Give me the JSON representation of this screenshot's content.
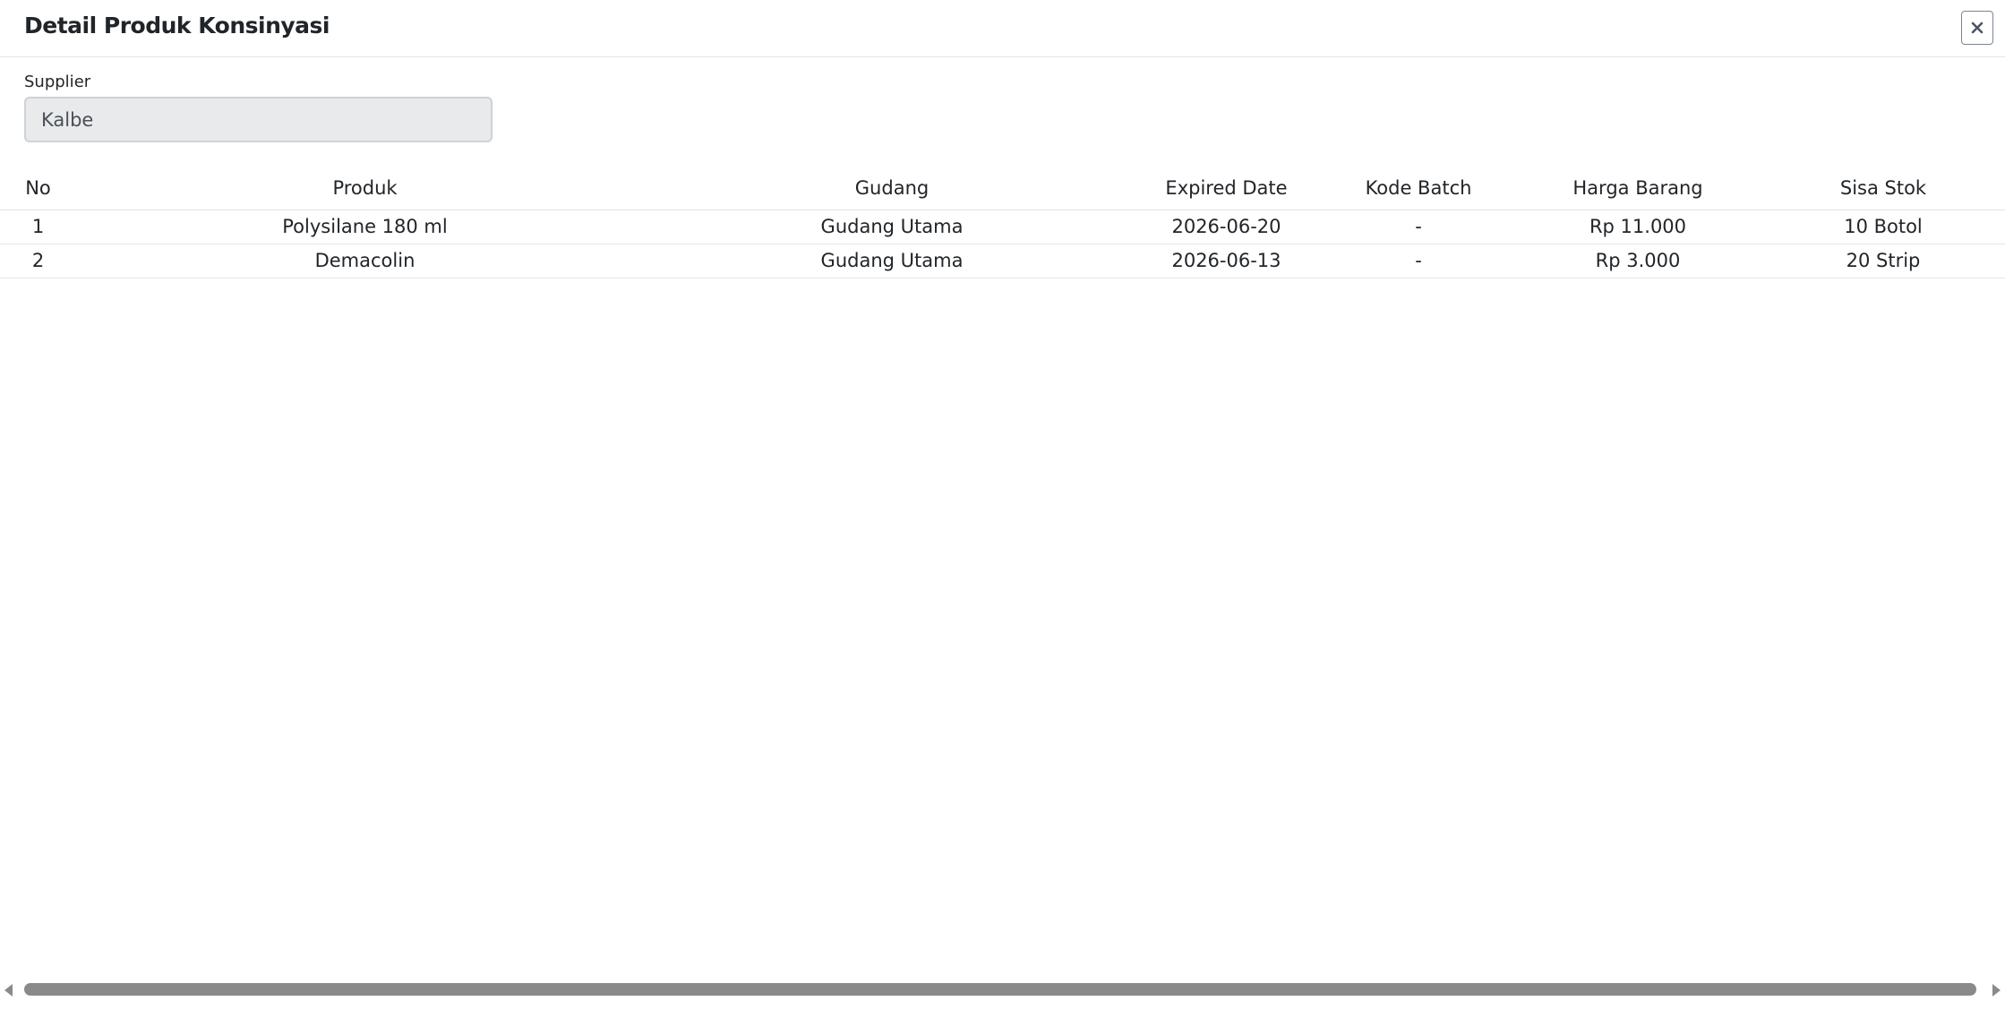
{
  "modal": {
    "title": "Detail Produk Konsinyasi",
    "close_icon": "close-icon"
  },
  "supplier": {
    "label": "Supplier",
    "value": "Kalbe"
  },
  "table": {
    "headers": [
      "No",
      "Produk",
      "Gudang",
      "Expired Date",
      "Kode Batch",
      "Harga Barang",
      "Sisa Stok"
    ],
    "rows": [
      [
        "1",
        "Polysilane 180 ml",
        "Gudang Utama",
        "2026-06-20",
        "-",
        "Rp 11.000",
        "10 Botol"
      ],
      [
        "2",
        "Demacolin",
        "Gudang Utama",
        "2026-06-13",
        "-",
        "Rp 3.000",
        "20 Strip"
      ]
    ]
  },
  "colors": {
    "input_bg": "#e9eaec",
    "scrollbar": "#8a8a8a",
    "divider": "#dee2e6"
  }
}
